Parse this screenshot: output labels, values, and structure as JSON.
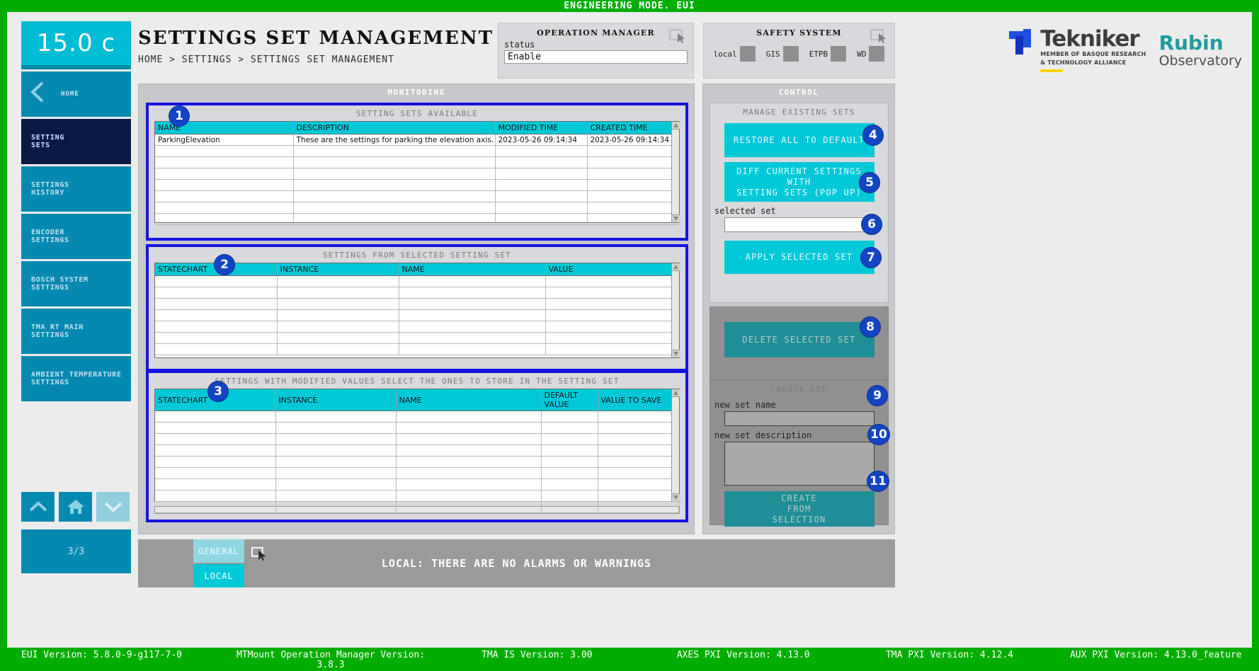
{
  "top_bar": {
    "text": "ENGINEERING MODE. EUI"
  },
  "sidebar": {
    "temperature": "15.0 c",
    "home": {
      "label": "HOME",
      "icon": "chevron-left-icon"
    },
    "items": [
      {
        "line1": "SETTING",
        "line2": "SETS",
        "active": true
      },
      {
        "line1": "SETTINGS",
        "line2": "HISTORY",
        "active": false
      },
      {
        "line1": "ENCODER",
        "line2": "SETTINGS",
        "active": false
      },
      {
        "line1": "BOSCH SYSTEM",
        "line2": "SETTINGS",
        "active": false
      },
      {
        "line1": "TMA RT MAIN",
        "line2": "SETTINGS",
        "active": false
      },
      {
        "line1": "AMBIENT TEMPERATURE",
        "line2": "SETTINGS",
        "active": false
      }
    ],
    "page_count": "3/3",
    "nav_buttons": [
      "chevron-up-icon",
      "home-icon",
      "chevron-down-icon"
    ]
  },
  "header": {
    "title": "SETTINGS SET MANAGEMENT",
    "breadcrumb": "HOME > SETTINGS > SETTINGS SET MANAGEMENT"
  },
  "operation_manager": {
    "title": "OPERATION MANAGER",
    "status_label": "status",
    "status_value": "Enable"
  },
  "safety_system": {
    "title": "SAFETY SYSTEM",
    "indicators": [
      {
        "label": "local",
        "state": "off"
      },
      {
        "label": "GIS",
        "state": "off"
      },
      {
        "label": "ETPB",
        "state": "off"
      },
      {
        "label": "WD",
        "state": "off"
      }
    ]
  },
  "logos": {
    "tekniker_name": "Tekniker",
    "tekniker_sub1": "MEMBER OF BASQUE RESEARCH",
    "tekniker_sub2": "& TECHNOLOGY ALLIANCE",
    "rubin_top": "Rubin",
    "rubin_bottom": "Observatory"
  },
  "monitoring": {
    "title": "MONITORING",
    "setting_sets_available": {
      "caption": "SETTING SETS AVAILABLE",
      "badge": "1",
      "columns": [
        "NAME",
        "DESCRIPTION",
        "MODIFIED TIME",
        "CREATED TIME"
      ],
      "rows": [
        [
          "ParkingElevation",
          "These are the settings for parking the elevation axis.",
          "2023-05-26 09:14:34",
          "2023-05-26 09:14:34"
        ],
        [
          "",
          "",
          "",
          ""
        ],
        [
          "",
          "",
          "",
          ""
        ],
        [
          "",
          "",
          "",
          ""
        ],
        [
          "",
          "",
          "",
          ""
        ],
        [
          "",
          "",
          "",
          ""
        ],
        [
          "",
          "",
          "",
          ""
        ],
        [
          "",
          "",
          "",
          ""
        ]
      ]
    },
    "settings_from_selected": {
      "caption": "SETTINGS FROM SELECTED SETTING SET",
      "badge": "2",
      "columns": [
        "STATECHART",
        "INSTANCE",
        "NAME",
        "VALUE"
      ],
      "rows": [
        [
          "",
          "",
          "",
          ""
        ],
        [
          "",
          "",
          "",
          ""
        ],
        [
          "",
          "",
          "",
          ""
        ],
        [
          "",
          "",
          "",
          ""
        ],
        [
          "",
          "",
          "",
          ""
        ],
        [
          "",
          "",
          "",
          ""
        ],
        [
          "",
          "",
          "",
          ""
        ],
        [
          "",
          "",
          "",
          ""
        ]
      ]
    },
    "settings_modified": {
      "caption": "SETTINGS WITH MODIFIED VALUES SELECT THE ONES TO STORE IN THE SETTING SET",
      "badge": "3",
      "columns": [
        "STATECHART",
        "INSTANCE",
        "NAME",
        "DEFAULT VALUE",
        "VALUE TO SAVE"
      ],
      "rows": [
        [
          "",
          "",
          "",
          "",
          ""
        ],
        [
          "",
          "",
          "",
          "",
          ""
        ],
        [
          "",
          "",
          "",
          "",
          ""
        ],
        [
          "",
          "",
          "",
          "",
          ""
        ],
        [
          "",
          "",
          "",
          "",
          ""
        ],
        [
          "",
          "",
          "",
          "",
          ""
        ],
        [
          "",
          "",
          "",
          "",
          ""
        ],
        [
          "",
          "",
          "",
          "",
          ""
        ],
        [
          "",
          "",
          "",
          "",
          ""
        ],
        [
          "",
          "",
          "",
          "",
          ""
        ]
      ]
    }
  },
  "control": {
    "title": "CONTROL",
    "manage_existing": {
      "caption": "MANAGE EXISTING SETS",
      "restore_all": "RESTORE ALL TO DEFAULT",
      "restore_badge": "4",
      "diff_line1": "DIFF CURRENT SETTINGS",
      "diff_line2": "WITH",
      "diff_line3": "SETTING SETS (POP UP)",
      "diff_badge": "5",
      "selected_set_label": "selected set",
      "selected_set_value": "",
      "selected_set_badge": "6",
      "apply_selected": "APPLY SELECTED SET",
      "apply_badge": "7"
    },
    "delete_section": {
      "delete_selected": "DELETE SELECTED SET",
      "delete_badge": "8"
    },
    "create_set": {
      "caption": "CREATE SET",
      "name_label": "new set name",
      "name_value": "",
      "name_badge": "9",
      "description_label": "new set description",
      "description_value": "",
      "description_badge": "10",
      "create_line1": "CREATE",
      "create_line2": "FROM",
      "create_line3": "SELECTION",
      "create_badge": "11"
    }
  },
  "alarm_bar": {
    "tab_general": "GENERAL",
    "tab_local": "LOCAL",
    "message": "LOCAL: THERE ARE NO ALARMS OR WARNINGS"
  },
  "versions": [
    "EUI Version: 5.8.0-9-g117-7-0",
    "MTMount Operation Manager Version: 3.8.3",
    "TMA IS Version: 3.00",
    "AXES PXI Version: 4.13.0",
    "TMA PXI Version: 4.12.4",
    "AUX PXI Version: 4.13.0_feature"
  ],
  "colors": {
    "green": "#00ad00",
    "cyan": "#00c8d7",
    "blue_sidebar": "#0689b0",
    "active_nav": "#061a44",
    "callout_blue": "#1344c4",
    "border_blue": "#1414e0"
  }
}
